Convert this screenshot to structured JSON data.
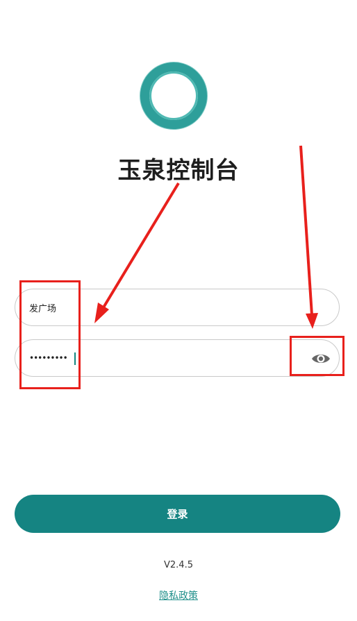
{
  "app": {
    "title": "玉泉控制台"
  },
  "login_form": {
    "username_value": "发广场",
    "password_value": "•••••••••",
    "password_toggle_icon": "eye-icon",
    "submit_label": "登录"
  },
  "footer": {
    "version": "V2.4.5",
    "privacy_link": "隐私政策"
  },
  "colors": {
    "accent": "#158482",
    "logo_ring": "#2e9f9a",
    "annotation": "#e8201c"
  }
}
